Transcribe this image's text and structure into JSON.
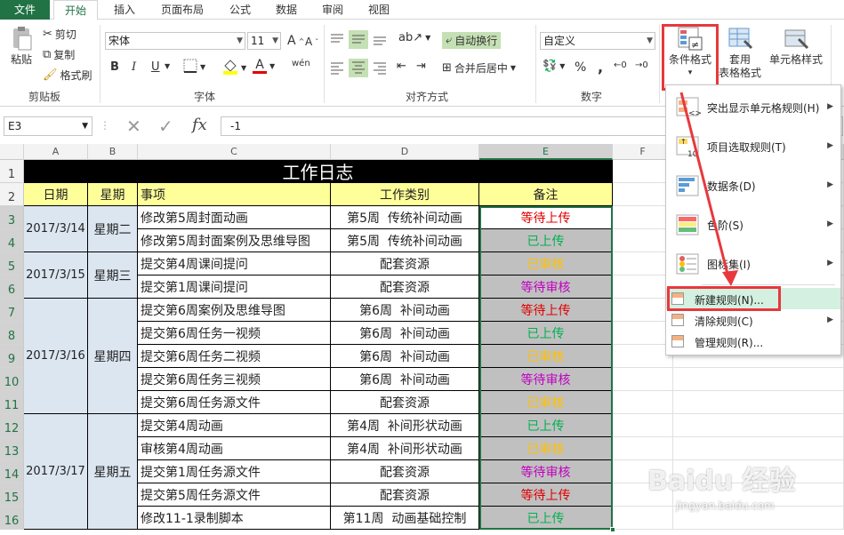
{
  "tabs": [
    "文件",
    "开始",
    "插入",
    "页面布局",
    "公式",
    "数据",
    "审阅",
    "视图"
  ],
  "ribbon": {
    "clipboard": {
      "paste": "粘贴",
      "cut": "剪切",
      "copy": "复制",
      "format_painter": "格式刷",
      "label": "剪贴板"
    },
    "font": {
      "name": "宋体",
      "size": "11",
      "bold": "B",
      "italic": "I",
      "underline": "U",
      "label": "字体",
      "grow": "A",
      "shrink": "A",
      "font_color_glyph": "A",
      "phonetic": "wén"
    },
    "align": {
      "wrap": "自动换行",
      "merge": "合并后居中",
      "label": "对齐方式"
    },
    "number": {
      "format": "自定义",
      "percent": "%",
      "comma": ",",
      "label": "数字"
    },
    "styles": {
      "cond_format_line1": "条件格式",
      "cond_format_arrow": "▾",
      "table_format_line1": "套用",
      "table_format_line2": "表格格式",
      "cell_style_line1": "单元格样式"
    }
  },
  "formula_bar": {
    "name_box": "E3",
    "value": "-1",
    "fx": "fx"
  },
  "columns": [
    "A",
    "B",
    "C",
    "D",
    "E",
    "F"
  ],
  "rows": [
    "1",
    "2",
    "3",
    "4",
    "5",
    "6",
    "7",
    "8",
    "9",
    "10",
    "11",
    "12",
    "13",
    "14",
    "15",
    "16"
  ],
  "sheet": {
    "title": "工作日志",
    "headers": [
      "日期",
      "星期",
      "事项",
      "工作类别",
      "备注"
    ],
    "dates": [
      {
        "date": "2017/3/14",
        "week": "星期二"
      },
      {
        "date": "2017/3/15",
        "week": "星期三"
      },
      {
        "date": "2017/3/16",
        "week": "星期四"
      },
      {
        "date": "2017/3/17",
        "week": "星期五"
      }
    ],
    "rows": [
      {
        "item": "修改第5周封面动画",
        "cat": "第5周  传统补间动画",
        "note": "等待上传",
        "color": "#e00000"
      },
      {
        "item": "修改第5周封面案例及思维导图",
        "cat": "第5周  传统补间动画",
        "note": "已上传",
        "color": "#00b050"
      },
      {
        "item": "提交第4周课间提问",
        "cat": "配套资源",
        "note": "已审核",
        "color": "#ffc000"
      },
      {
        "item": "提交第1周课间提问",
        "cat": "配套资源",
        "note": "等待审核",
        "color": "#c000c0"
      },
      {
        "item": "提交第6周案例及思维导图",
        "cat": "第6周  补间动画",
        "note": "等待上传",
        "color": "#e00000"
      },
      {
        "item": "提交第6周任务一视频",
        "cat": "第6周  补间动画",
        "note": "已上传",
        "color": "#00b050"
      },
      {
        "item": "提交第6周任务二视频",
        "cat": "第6周  补间动画",
        "note": "已审核",
        "color": "#ffc000"
      },
      {
        "item": "提交第6周任务三视频",
        "cat": "第6周  补间动画",
        "note": "等待审核",
        "color": "#c000c0"
      },
      {
        "item": "提交第6周任务源文件",
        "cat": "配套资源",
        "note": "已审核",
        "color": "#ffc000"
      },
      {
        "item": "提交第4周动画",
        "cat": "第4周  补间形状动画",
        "note": "已上传",
        "color": "#00b050"
      },
      {
        "item": "审核第4周动画",
        "cat": "第4周  补间形状动画",
        "note": "已审核",
        "color": "#ffc000"
      },
      {
        "item": "提交第1周任务源文件",
        "cat": "配套资源",
        "note": "等待审核",
        "color": "#c000c0"
      },
      {
        "item": "提交第5周任务源文件",
        "cat": "配套资源",
        "note": "等待上传",
        "color": "#e00000"
      },
      {
        "item": "修改11-1录制脚本",
        "cat": "第11周  动画基础控制",
        "note": "已上传",
        "color": "#00b050"
      }
    ]
  },
  "menu": {
    "items": [
      {
        "label": "突出显示单元格规则(H)",
        "icon": "highlight-rules-icon"
      },
      {
        "label": "项目选取规则(T)",
        "icon": "top-bottom-rules-icon"
      },
      {
        "label": "数据条(D)",
        "icon": "data-bars-icon"
      },
      {
        "label": "色阶(S)",
        "icon": "color-scales-icon"
      },
      {
        "label": "图标集(I)",
        "icon": "icon-sets-icon"
      }
    ],
    "small": [
      {
        "label": "新建规则(N)..."
      },
      {
        "label": "清除规则(C)"
      },
      {
        "label": "管理规则(R)..."
      }
    ]
  },
  "watermark": {
    "logo": "Baidu 经验",
    "url": "jingyan.baidu.com"
  },
  "colors": {
    "accent": "#217346",
    "highlight": "#e8383d",
    "header_fill": "#ffff99",
    "merged_fill": "#dce6f1",
    "title_fill": "#000000",
    "note_fill": "#c0c0c0"
  }
}
